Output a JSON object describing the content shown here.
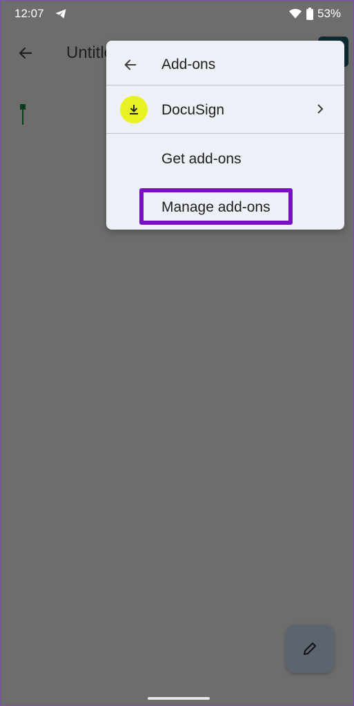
{
  "status_bar": {
    "time": "12:07",
    "battery": "53%",
    "icons": [
      "telegram-icon",
      "wifi-icon",
      "battery-icon"
    ]
  },
  "app_bar": {
    "title": "Untitled",
    "back_icon": "back-arrow-icon"
  },
  "addons_menu": {
    "title": "Add-ons",
    "items": [
      {
        "label": "DocuSign",
        "icon": "download-icon",
        "has_submenu": true
      },
      {
        "label": "Get add-ons"
      },
      {
        "label": "Manage add-ons",
        "highlighted": true
      }
    ]
  },
  "fab": {
    "icon": "pencil-icon"
  },
  "colors": {
    "scrim": "#6d6d6d",
    "menu_bg": "#eef0f8",
    "docusign_badge": "#e8f222",
    "highlight": "#7a10c4"
  }
}
